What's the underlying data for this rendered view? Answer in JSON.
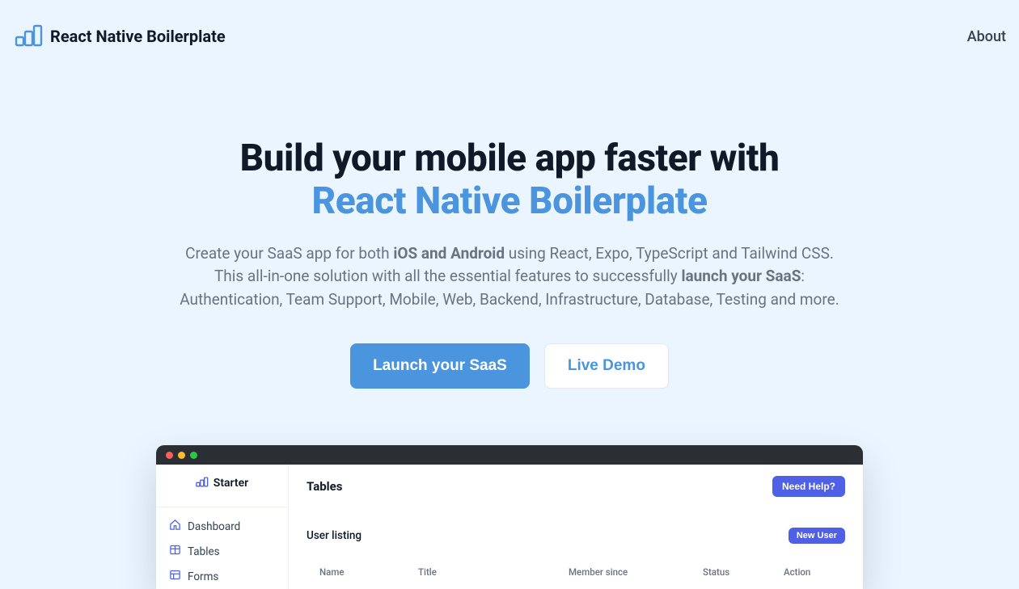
{
  "header": {
    "brand": "React Native Boilerplate",
    "about": "About"
  },
  "hero": {
    "title_line1": "Build your mobile app faster with",
    "title_line2": "React Native Boilerplate",
    "desc_p1_a": "Create your SaaS app for both ",
    "desc_p1_bold": "iOS and Android",
    "desc_p1_b": " using React, Expo, TypeScript and Tailwind CSS.",
    "desc_p2_a": "This all-in-one solution with all the essential features to successfully ",
    "desc_p2_bold": "launch your SaaS",
    "desc_p2_b": ":",
    "desc_p3": "Authentication, Team Support, Mobile, Web, Backend, Infrastructure, Database, Testing and more.",
    "cta_primary": "Launch your SaaS",
    "cta_secondary": "Live Demo"
  },
  "preview": {
    "sidebar_brand": "Starter",
    "side_items": {
      "dashboard": "Dashboard",
      "tables": "Tables",
      "forms": "Forms"
    },
    "main_title": "Tables",
    "help": "Need Help?",
    "user_listing": "User listing",
    "new_user": "New User",
    "columns": {
      "name": "Name",
      "title": "Title",
      "member": "Member since",
      "status": "Status",
      "action": "Action"
    }
  }
}
